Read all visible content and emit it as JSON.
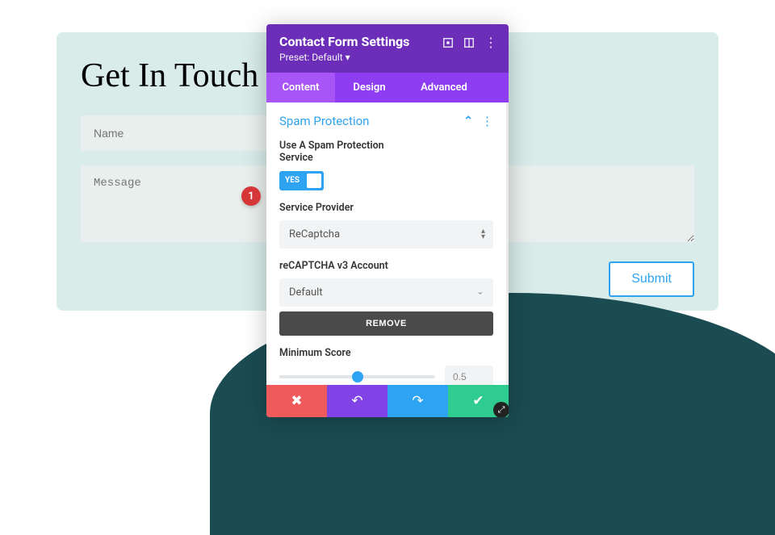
{
  "page": {
    "title": "Get In Touch",
    "name_placeholder": "Name",
    "message_placeholder": "Message",
    "submit_label": "Submit"
  },
  "modal": {
    "title": "Contact Form Settings",
    "preset_label": "Preset: Default ▾",
    "tabs": [
      "Content",
      "Design",
      "Advanced"
    ],
    "active_tab": 0,
    "section_title": "Spam Protection",
    "fields": {
      "spam_toggle_label": "Use A Spam Protection Service",
      "spam_toggle_value": "YES",
      "provider_label": "Service Provider",
      "provider_value": "ReCaptcha",
      "account_label": "reCAPTCHA v3 Account",
      "account_value": "Default",
      "remove_label": "REMOVE",
      "score_label": "Minimum Score",
      "score_value": "0.5"
    }
  },
  "badge": "1"
}
